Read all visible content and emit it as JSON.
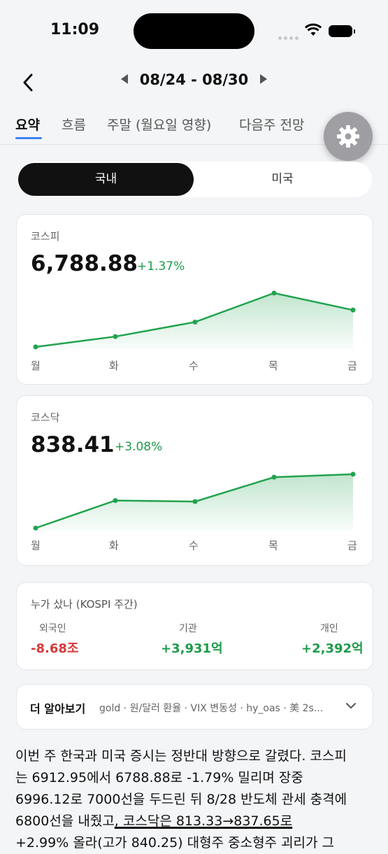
{
  "status": {
    "time": "11:09"
  },
  "nav": {
    "week_range": "08/24 - 08/30"
  },
  "tabs": [
    "요약",
    "흐름",
    "주말 (월요일 영향)",
    "다음주 전망"
  ],
  "segment": {
    "active": "국내",
    "inactive": "미국"
  },
  "colors": {
    "accent": "#3b82f6",
    "positive": "#1e9b4a",
    "negative": "#d63a3a",
    "line": "#22a34f"
  },
  "days": [
    "월",
    "화",
    "수",
    "목",
    "금"
  ],
  "kospi": {
    "label": "코스피",
    "value": "6,788.88",
    "change": "+1.37%"
  },
  "kosdaq": {
    "label": "코스닥",
    "value": "838.41",
    "change": "+3.08%"
  },
  "chart_data": [
    {
      "type": "area",
      "x": [
        "월",
        "화",
        "수",
        "목",
        "금"
      ],
      "values": [
        6700,
        6725,
        6760,
        6830,
        6789
      ]
    },
    {
      "type": "area",
      "x": [
        "월",
        "화",
        "수",
        "목",
        "금"
      ],
      "values": [
        813,
        826,
        825.5,
        837,
        838.4
      ]
    }
  ],
  "flows": {
    "title": "누가 샀나 (KOSPI 주간)",
    "foreign_label": "외국인",
    "foreign_value": "-8.68조",
    "inst_label": "기관",
    "inst_value": "+3,931억",
    "retail_label": "개인",
    "retail_value": "+2,392억"
  },
  "more": {
    "title": "더 알아보기",
    "tags": "gold · 원/달러 환율 · VIX 변동성 · hy_oas · 美 2s..."
  },
  "summary": {
    "line1": "이번 주 한국과 미국 증시는 정반대 방향으로 갈렸다. 코스피",
    "line2": "는 6912.95에서 6788.88로 -1.79% 밀리며 장중",
    "line3": "6996.12로 7000선을 두드린 뒤 8/28 반도체 관세 충격에",
    "line4a": "6800선을 내줬고",
    "line4b": ", 코스닥은 813.33→837.65로",
    "line5": "+2.99% 올라(고가 840.25) 대형주 중소형주 괴리가 그"
  }
}
